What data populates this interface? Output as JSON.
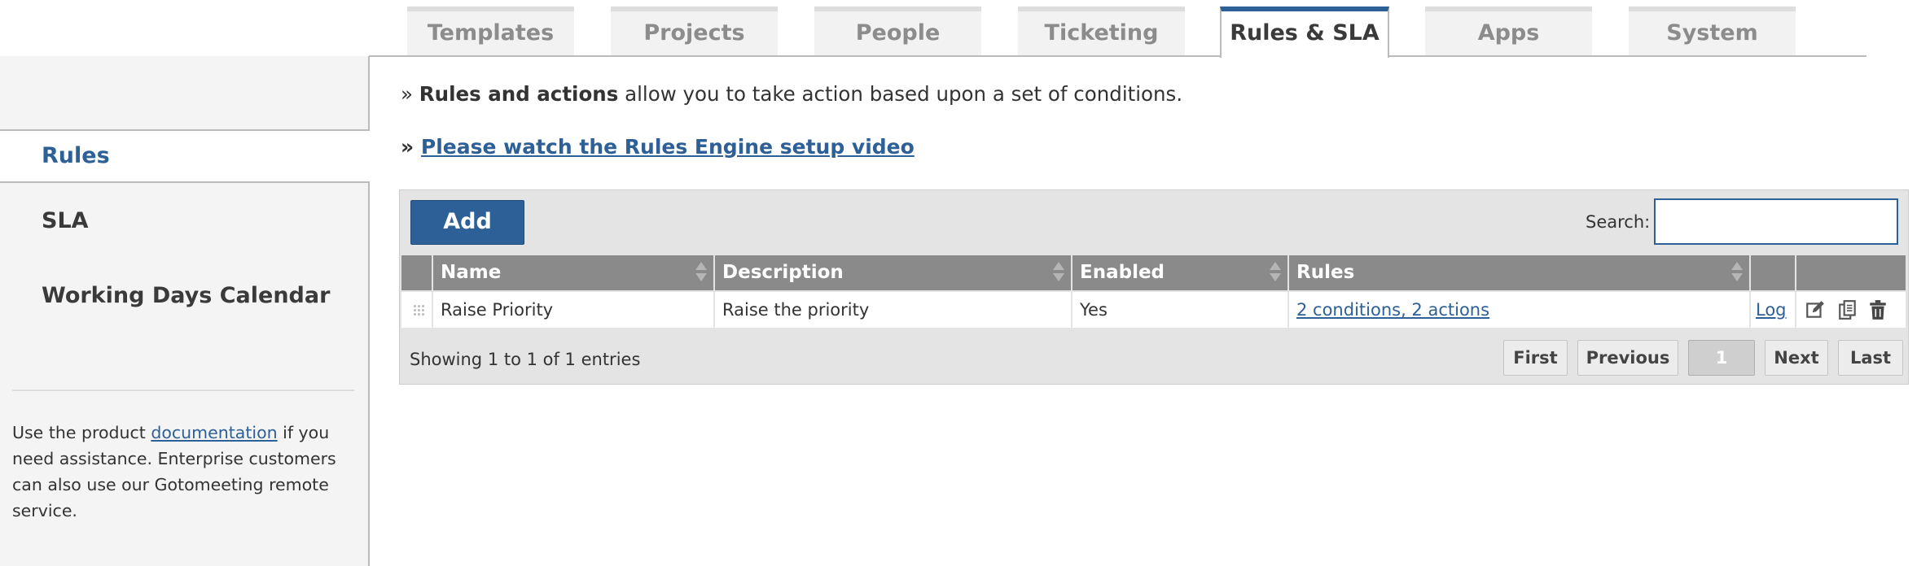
{
  "tabs": [
    {
      "label": "Templates",
      "active": false
    },
    {
      "label": "Projects",
      "active": false
    },
    {
      "label": "People",
      "active": false
    },
    {
      "label": "Ticketing",
      "active": false
    },
    {
      "label": "Rules & SLA",
      "active": true
    },
    {
      "label": "Apps",
      "active": false
    },
    {
      "label": "System",
      "active": false
    }
  ],
  "sidebar": {
    "items": [
      {
        "label": "Rules",
        "active": true
      },
      {
        "label": "SLA",
        "active": false
      },
      {
        "label": "Working Days Calendar",
        "active": false
      }
    ],
    "help": {
      "before": "Use the product ",
      "link": "documentation",
      "after": " if you need assistance. Enterprise customers can also use our Gotomeeting remote service."
    }
  },
  "intro": {
    "bullet": "»",
    "bold": "Rules and actions",
    "rest": " allow you to take action based upon a set of conditions."
  },
  "video": {
    "bullet": "»",
    "link": "Please watch the Rules Engine setup video"
  },
  "table": {
    "add_label": "Add",
    "search_label": "Search:",
    "search_value": "",
    "columns": [
      "Name",
      "Description",
      "Enabled",
      "Rules"
    ],
    "rows": [
      {
        "name": "Raise Priority",
        "description": "Raise the priority",
        "enabled": "Yes",
        "rules": "2 conditions, 2 actions",
        "log": "Log",
        "action_icons": [
          "edit-icon",
          "copy-icon",
          "delete-icon"
        ]
      }
    ],
    "info": "Showing 1 to 1 of 1 entries",
    "pagination": {
      "first": "First",
      "previous": "Previous",
      "current": "1",
      "next": "Next",
      "last": "Last"
    }
  },
  "colors": {
    "accent": "#2e6098",
    "header_bg": "#8a8a8a",
    "panel_bg": "#e4e4e4"
  }
}
